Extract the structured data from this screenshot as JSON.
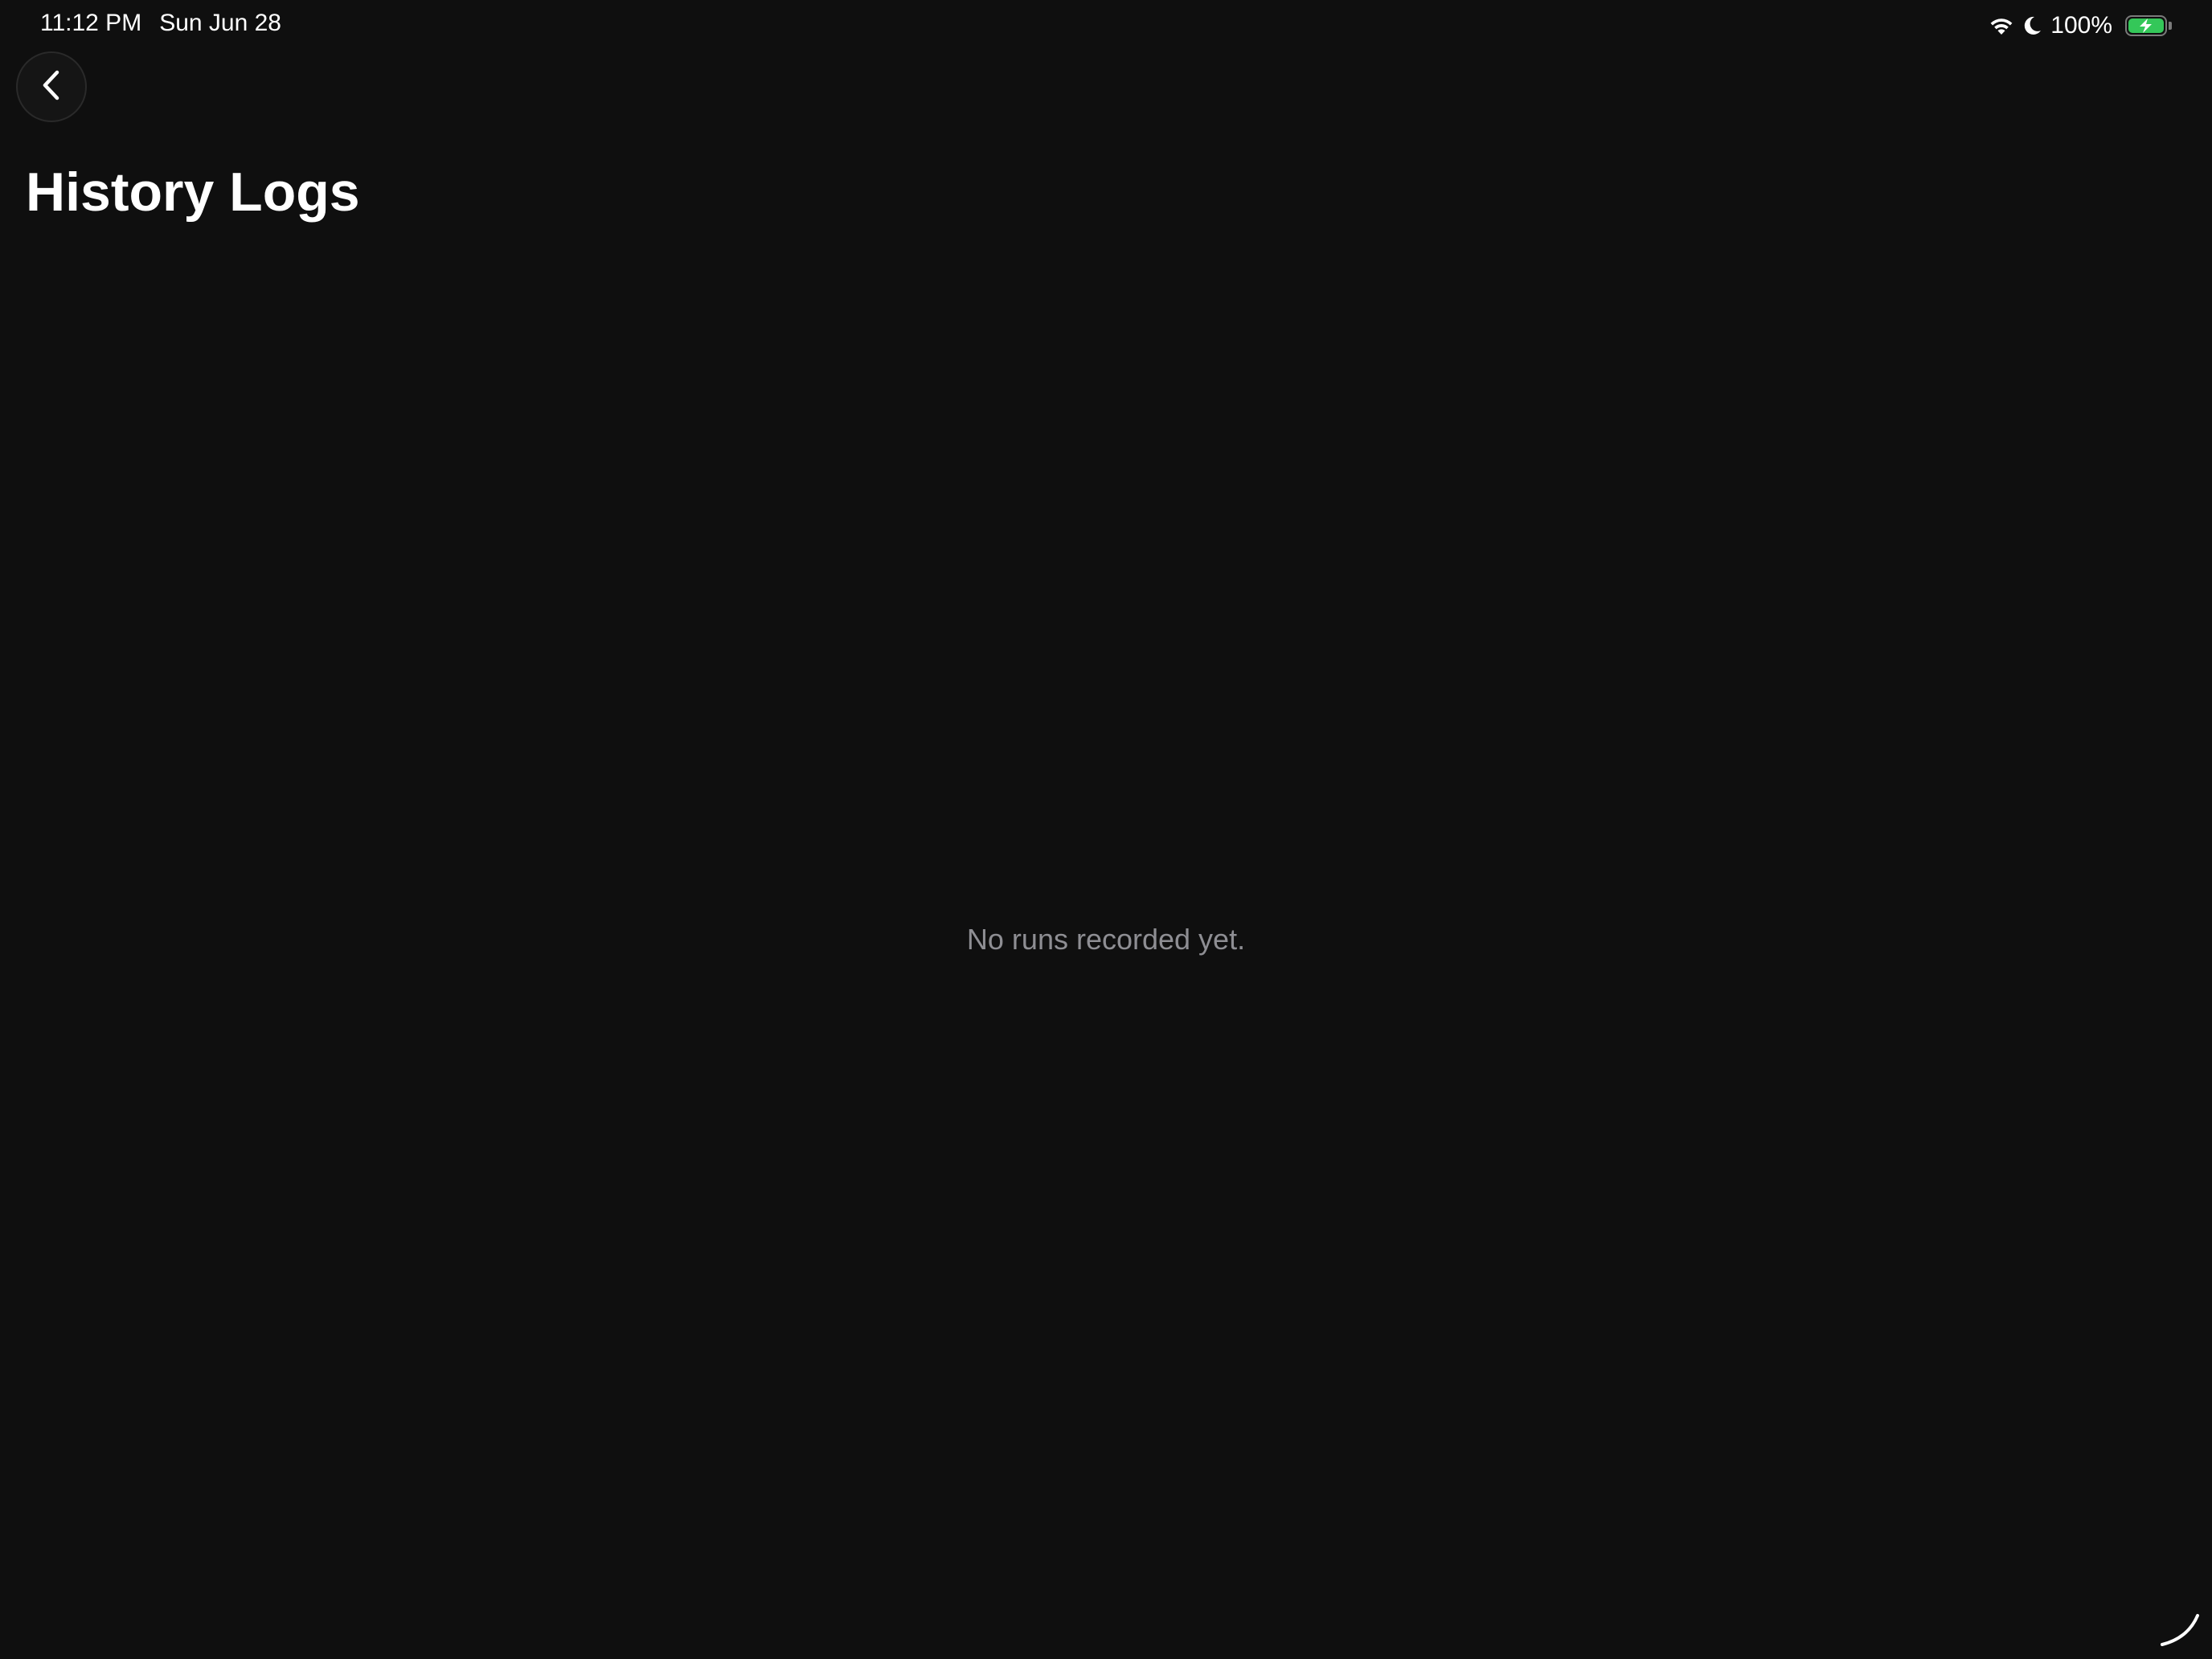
{
  "status_bar": {
    "time": "11:12 PM",
    "date": "Sun Jun 28",
    "battery_percent_text": "100%",
    "battery_level": 1.0,
    "icons": [
      "wifi-icon",
      "moon-icon",
      "battery-charging-icon"
    ]
  },
  "header": {
    "back_icon": "chevron-left-icon",
    "title": "History Logs"
  },
  "main": {
    "empty_message": "No runs recorded yet."
  },
  "colors": {
    "background": "#0f0f0f",
    "title": "#ffffff",
    "muted_text": "#8e8e93",
    "battery_green": "#34c759"
  }
}
